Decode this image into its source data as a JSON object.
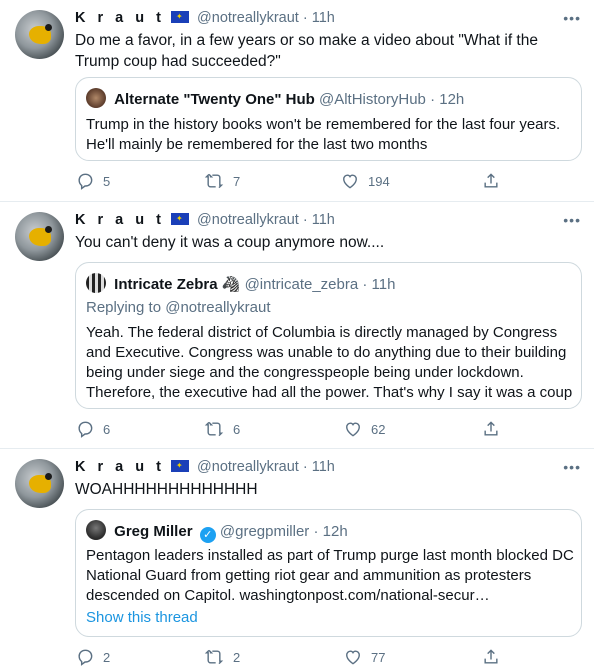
{
  "tweets": [
    {
      "name": "K r a u t",
      "handle": "@notreallykraut",
      "dot": "·",
      "time": "11h",
      "more": "•••",
      "text": "Do me a favor, in a few years or so make a video about \"What if the Trump coup had succeeded?\"",
      "quote": {
        "name": "Alternate \"Twenty One\" Hub",
        "handle": "@AltHistoryHub",
        "dot": "·",
        "time": "12h",
        "text": "Trump in the history books won't be remembered for the last four years. He'll mainly be remembered for the last two months"
      },
      "replies": "5",
      "retweets": "7",
      "likes": "194"
    },
    {
      "name": "K r a u t",
      "handle": "@notreallykraut",
      "dot": "·",
      "time": "11h",
      "more": "•••",
      "text": "You can't deny it was a coup anymore now....",
      "quote": {
        "name": "Intricate Zebra",
        "emoji": "🦓",
        "handle": "@intricate_zebra",
        "dot": "·",
        "time": "11h",
        "replying": "Replying to @notreallykraut",
        "text": "Yeah. The federal district of Columbia is directly managed by Congress and Executive. Congress was unable to do anything due to their building being under siege and the congresspeople being under lockdown. Therefore, the executive had all the power. That's why I say it was a coup"
      },
      "replies": "6",
      "retweets": "6",
      "likes": "62"
    },
    {
      "name": "K r a u t",
      "handle": "@notreallykraut",
      "dot": "·",
      "time": "11h",
      "more": "•••",
      "text": "WOAHHHHHHHHHHHHH",
      "quote": {
        "name": "Greg Miller",
        "verified": "✓",
        "handle": "@gregpmiller",
        "dot": "·",
        "time": "12h",
        "text": "Pentagon leaders installed as part of Trump purge last month blocked DC National Guard from getting riot gear and ammunition as protesters descended on Capitol. washingtonpost.com/national-secur…",
        "show_thread": "Show this thread"
      },
      "replies": "2",
      "retweets": "2",
      "likes": "77"
    }
  ],
  "icons": {
    "reply": "reply-icon",
    "retweet": "retweet-icon",
    "like": "heart-icon",
    "share": "share-icon"
  },
  "colors": {
    "accent": "#1b95e0",
    "muted": "#5b7083",
    "border": "#cfd9de"
  }
}
